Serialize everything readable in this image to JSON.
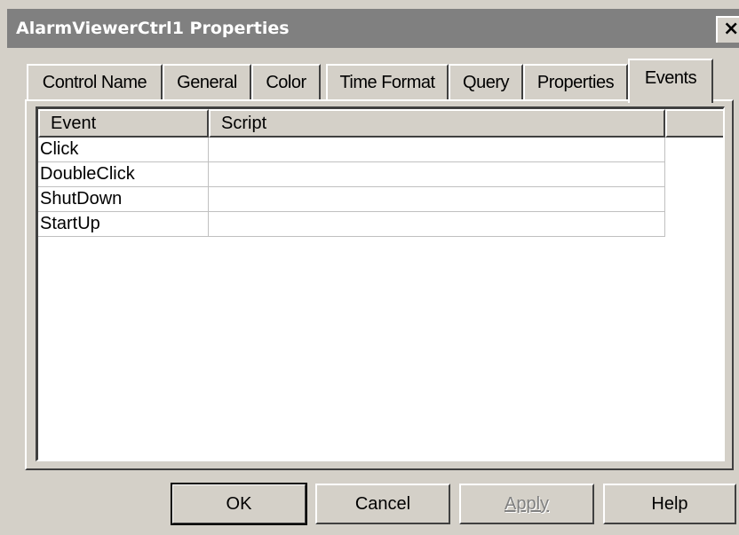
{
  "window": {
    "title": "AlarmViewerCtrl1 Properties",
    "close_glyph": "×"
  },
  "tabs": [
    {
      "label": "Control Name",
      "active": false
    },
    {
      "label": "General",
      "active": false
    },
    {
      "label": "Color",
      "active": false
    },
    {
      "label": "Time Format",
      "active": false
    },
    {
      "label": "Query",
      "active": false
    },
    {
      "label": "Properties",
      "active": false
    },
    {
      "label": "Events",
      "active": true
    }
  ],
  "grid": {
    "columns": [
      "Event",
      "Script"
    ],
    "rows": [
      {
        "event": "Click",
        "script": ""
      },
      {
        "event": "DoubleClick",
        "script": ""
      },
      {
        "event": "ShutDown",
        "script": ""
      },
      {
        "event": "StartUp",
        "script": ""
      }
    ]
  },
  "buttons": {
    "ok": "OK",
    "cancel": "Cancel",
    "apply": "Apply",
    "help": "Help",
    "apply_disabled": true
  },
  "colors": {
    "title_bar": "#808080",
    "face": "#d4d0c8"
  }
}
